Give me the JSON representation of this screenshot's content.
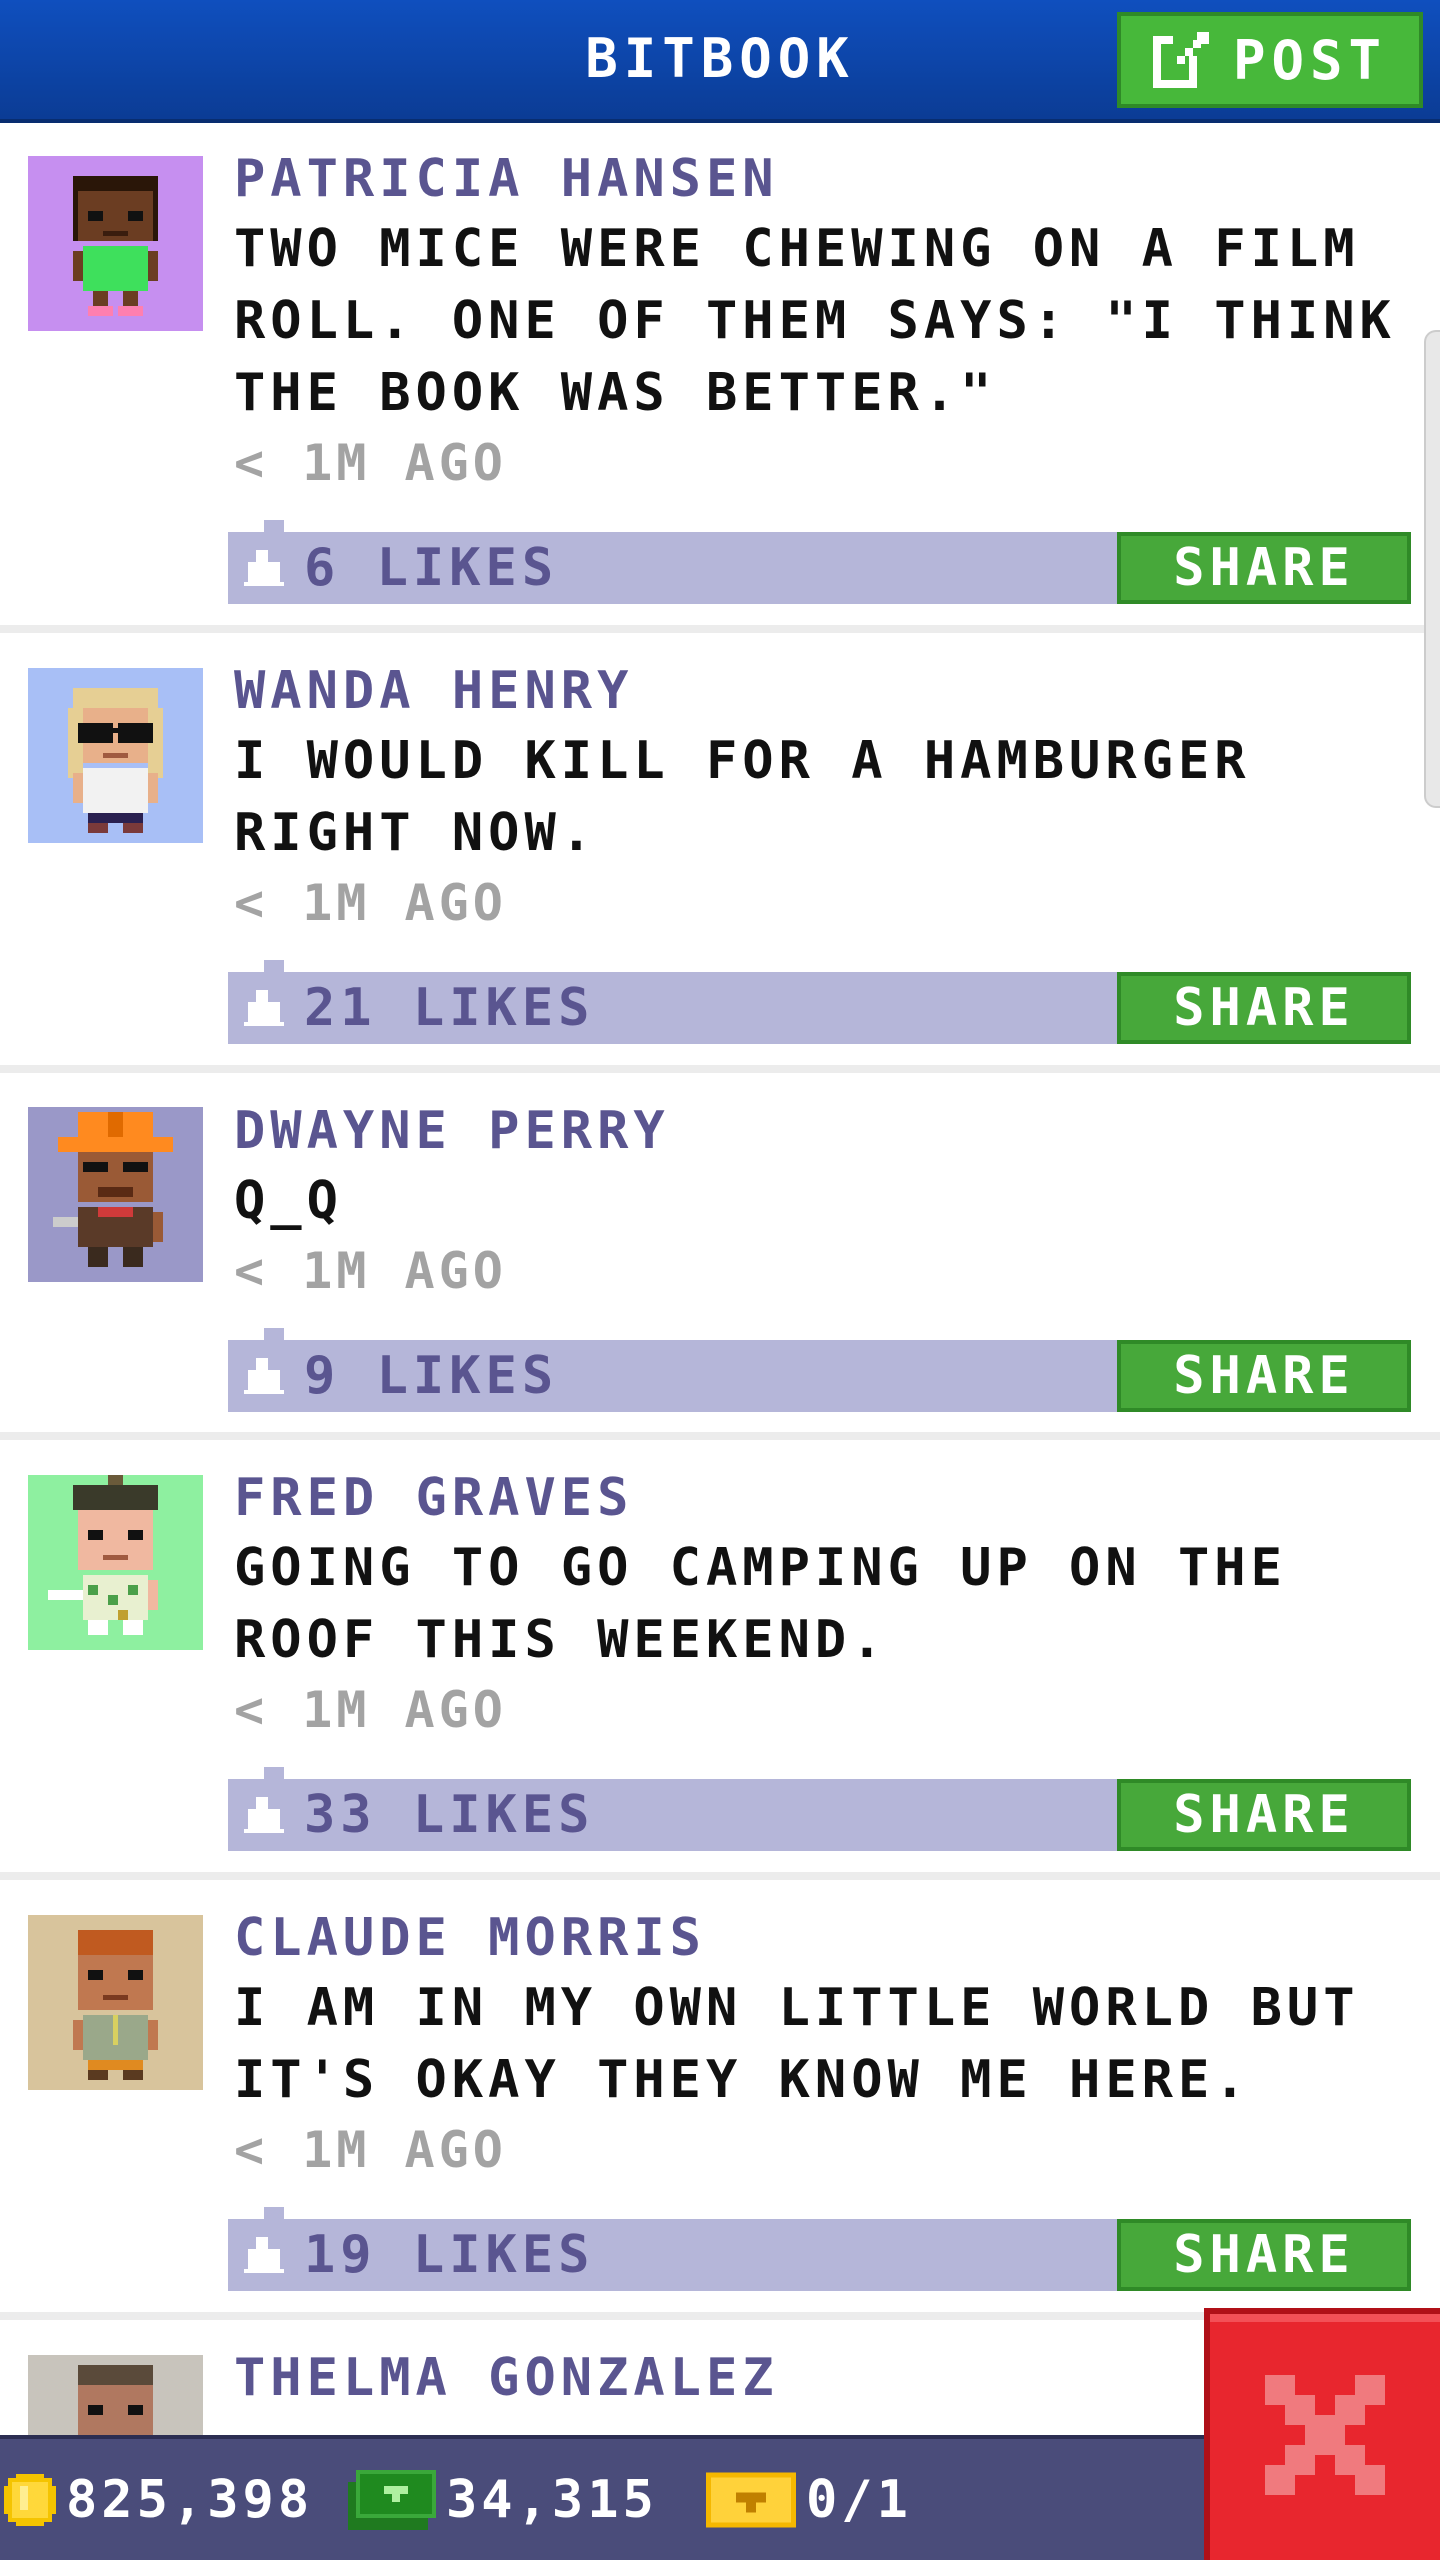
{
  "app": {
    "title": "BITBOOK",
    "post_button_label": "POST"
  },
  "feed": {
    "posts": [
      {
        "name": "PATRICIA HANSEN",
        "text": "TWO MICE WERE CHEWING ON A FILM ROLL. ONE OF THEM SAYS: \"I THINK THE BOOK WAS BETTER.\"",
        "time": "< 1M AGO",
        "likes": "6 LIKES",
        "share_label": "SHARE"
      },
      {
        "name": "WANDA HENRY",
        "text": "I WOULD KILL FOR A HAMBURGER RIGHT NOW.",
        "time": "< 1M AGO",
        "likes": "21 LIKES",
        "share_label": "SHARE"
      },
      {
        "name": "DWAYNE PERRY",
        "text": "Q_Q",
        "time": "< 1M AGO",
        "likes": "9 LIKES",
        "share_label": "SHARE"
      },
      {
        "name": "FRED GRAVES",
        "text": "GOING TO GO CAMPING UP ON THE ROOF THIS WEEKEND.",
        "time": "< 1M AGO",
        "likes": "33 LIKES",
        "share_label": "SHARE"
      },
      {
        "name": "CLAUDE MORRIS",
        "text": "I AM IN MY OWN LITTLE WORLD BUT IT'S OKAY THEY KNOW ME HERE.",
        "time": "< 1M AGO",
        "likes": "19 LIKES",
        "share_label": "SHARE"
      },
      {
        "name": "THELMA GONZALEZ"
      }
    ]
  },
  "status_bar": {
    "coins": "825,398",
    "bux": "34,315",
    "tickets": "0/1"
  },
  "icons": {
    "post": "edit-icon",
    "like": "thumbs-up-icon",
    "coin": "coin-icon",
    "bux": "cash-icon",
    "ticket": "ticket-icon",
    "close": "close-icon"
  },
  "colors": {
    "header": "#0f4fbe",
    "button_green": "#47b83a",
    "likes_bar": "#b5b6d9",
    "name_text": "#5a5590",
    "status_bar": "#4a4c7a",
    "close_red": "#e8262e"
  }
}
